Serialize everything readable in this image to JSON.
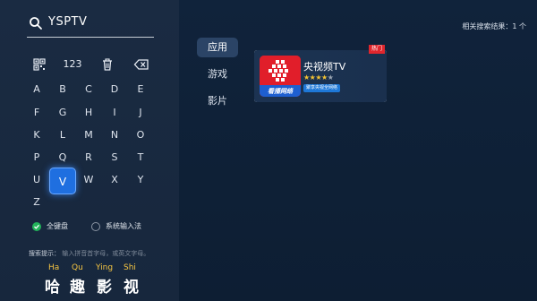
{
  "search": {
    "icon": "search-icon",
    "query": "YSPTV"
  },
  "keyboard": {
    "function_keys": [
      {
        "name": "qr-code-icon"
      },
      {
        "label": "123"
      },
      {
        "name": "trash-icon"
      },
      {
        "name": "backspace-icon"
      }
    ],
    "rows": [
      [
        "A",
        "B",
        "C",
        "D",
        "E"
      ],
      [
        "F",
        "G",
        "H",
        "I",
        "J"
      ],
      [
        "K",
        "L",
        "M",
        "N",
        "O"
      ],
      [
        "P",
        "Q",
        "R",
        "S",
        "T"
      ],
      [
        "U",
        "V",
        "W",
        "X",
        "Y"
      ],
      [
        "Z"
      ]
    ],
    "focused_key": "V",
    "accent_color": "#1f6fe0"
  },
  "input_mode": {
    "full_keyboard": {
      "label": "全键盘",
      "selected": true
    },
    "system_ime": {
      "label": "系统输入法",
      "selected": false
    }
  },
  "hint": {
    "prefix": "搜索提示：",
    "text": "输入拼音首字母，或英文字母。"
  },
  "example": {
    "pinyin": [
      "Ha",
      "Qu",
      "Ying",
      "Shi"
    ],
    "hanzi": [
      "哈",
      "趣",
      "影",
      "视"
    ]
  },
  "categories": [
    {
      "label": "应用",
      "active": true
    },
    {
      "label": "游戏",
      "active": false
    },
    {
      "label": "影片",
      "active": false
    }
  ],
  "results": {
    "count_text": "相关搜索结果：1 个",
    "items": [
      {
        "name": "央视频TV",
        "badge": "热门",
        "rating": 4,
        "rating_max": 5,
        "tag": "聚享央视全网络",
        "icon": "cctv-app-icon",
        "icon_text": "看播网络"
      }
    ]
  }
}
